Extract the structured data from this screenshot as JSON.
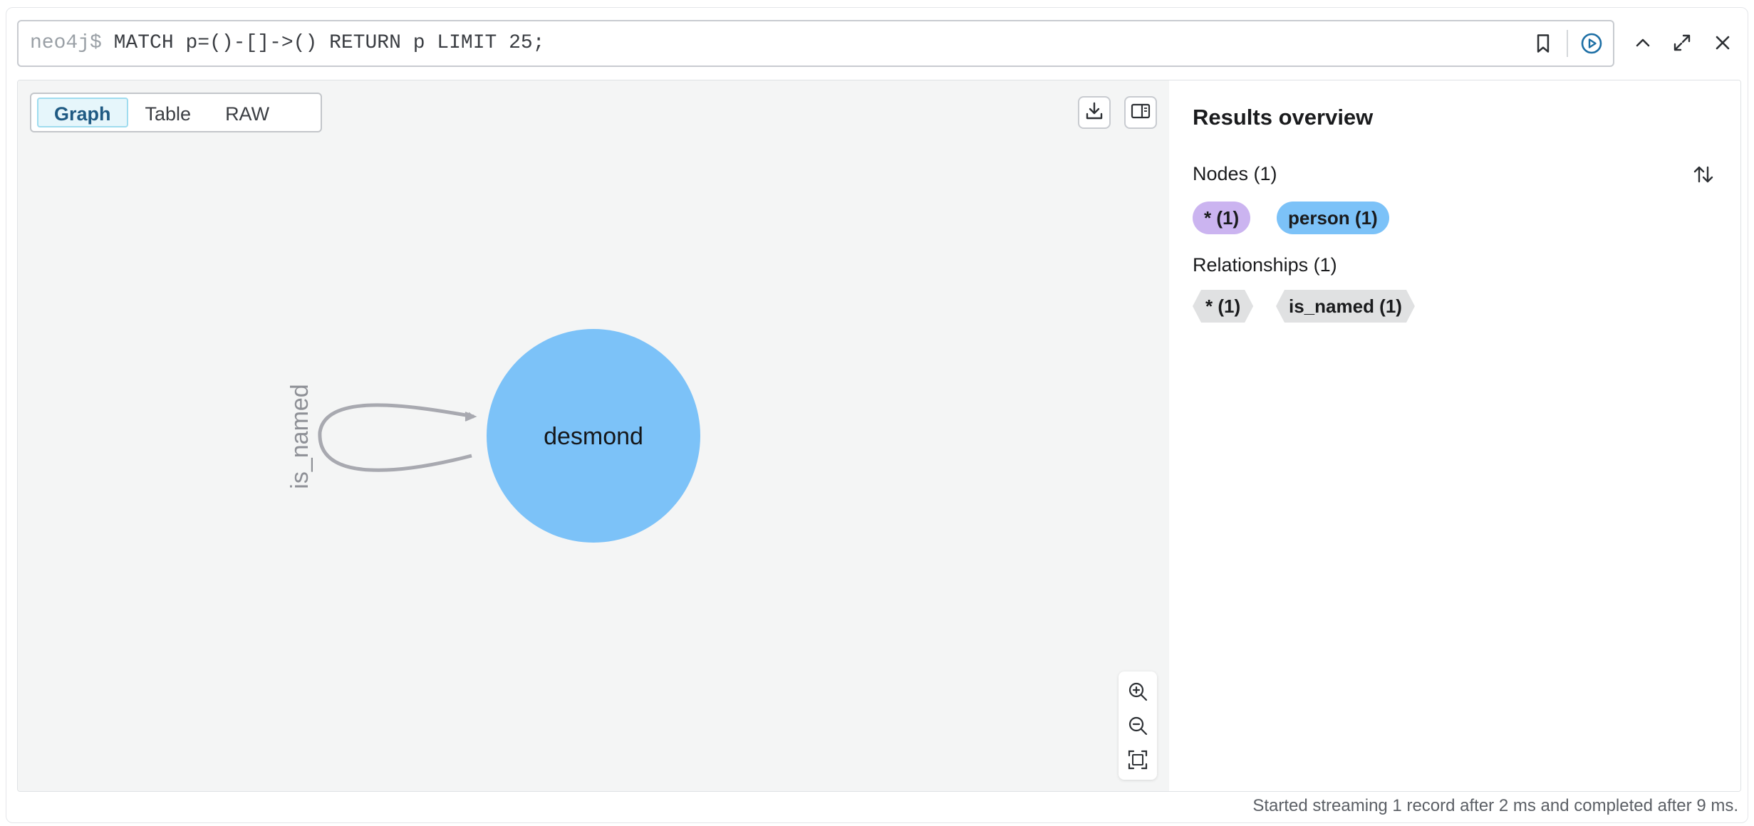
{
  "editor": {
    "prompt": "neo4j$",
    "query": " MATCH p=()-[]->() RETURN p LIMIT 25;"
  },
  "view_tabs": [
    {
      "label": "Graph",
      "active": true
    },
    {
      "label": "Table",
      "active": false
    },
    {
      "label": "RAW",
      "active": false
    }
  ],
  "graph": {
    "node": {
      "label": "desmond",
      "color": "#7cc2f8"
    },
    "relationship": {
      "label": "is_named",
      "color": "#a8a9b0"
    }
  },
  "overview": {
    "title": "Results overview",
    "nodes_label": "Nodes (1)",
    "node_pills": [
      {
        "label": "* (1)",
        "color": "#cbb4f0"
      },
      {
        "label": "person (1)",
        "color": "#7cc2f8"
      }
    ],
    "relationships_label": "Relationships (1)",
    "rel_pills": [
      {
        "label": "* (1)"
      },
      {
        "label": "is_named (1)"
      }
    ]
  },
  "status": "Started streaming 1 record after 2 ms and completed after 9 ms.",
  "icons": {
    "editor": [
      "bookmark-icon",
      "run-icon"
    ],
    "window": [
      "collapse-icon",
      "expand-icon",
      "close-icon"
    ],
    "canvas": [
      "download-icon",
      "side-panel-icon"
    ],
    "zoom": [
      "zoom-in-icon",
      "zoom-out-icon",
      "fit-icon"
    ],
    "panel": [
      "sort-icon"
    ]
  }
}
